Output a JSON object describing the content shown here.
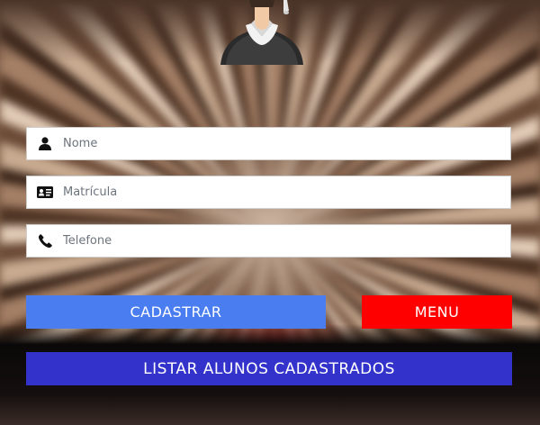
{
  "form": {
    "nome": {
      "placeholder": "Nome",
      "value": "",
      "icon": "user-icon"
    },
    "matricula": {
      "placeholder": "Matrícula",
      "value": "",
      "icon": "id-card-icon"
    },
    "telefone": {
      "placeholder": "Telefone",
      "value": "",
      "icon": "phone-icon"
    }
  },
  "buttons": {
    "cadastrar": {
      "label": "CADASTRAR",
      "color": "#4a7ef0"
    },
    "menu": {
      "label": "MENU",
      "color": "#ff0000"
    },
    "listar": {
      "label": "LISTAR ALUNOS CADASTRADOS",
      "color": "#3333cc"
    }
  },
  "avatar": {
    "icon": "student-avatar-icon"
  }
}
